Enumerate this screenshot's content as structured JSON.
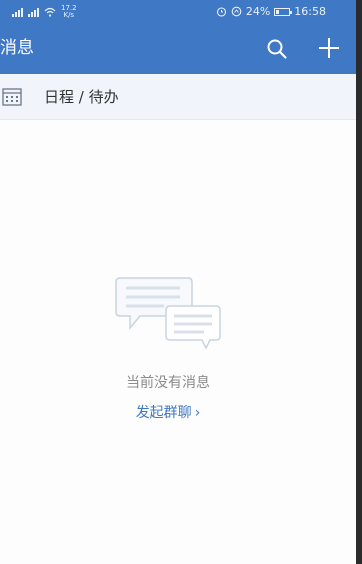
{
  "status_bar": {
    "network_speed_value": "17.2",
    "network_speed_unit": "K/s",
    "battery": "24%",
    "time": "16:58",
    "battery_level": 0.24,
    "icons": [
      "signal-icon",
      "signal-icon",
      "wifi-icon",
      "alarm-icon",
      "data-saver-icon",
      "battery-icon"
    ]
  },
  "app_bar": {
    "title": "消息",
    "icons": [
      "search-icon",
      "add-icon"
    ]
  },
  "schedule": {
    "label": "日程 / 待办",
    "icon": "calendar-icon"
  },
  "empty_state": {
    "message": "当前没有消息",
    "action_label": "发起群聊",
    "action_chevron": "›",
    "illustration": "chat-bubbles-icon"
  },
  "colors": {
    "primary": "#3f78c4",
    "schedule_bg": "#f1f5fb",
    "muted_text": "#8b8b8b"
  }
}
